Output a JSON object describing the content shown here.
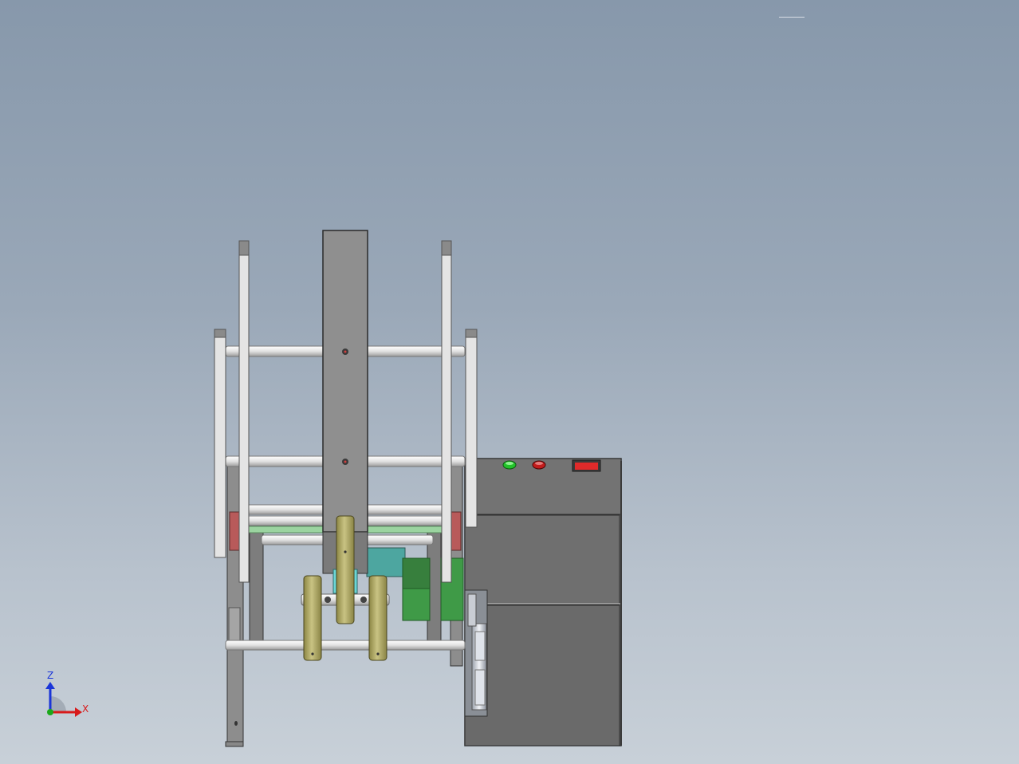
{
  "viewport": {
    "background_top": "#8798ab",
    "background_bottom": "#c8d0d8"
  },
  "triad": {
    "z_label": "Z",
    "x_label": "X",
    "z_color": "#1a35d8",
    "x_color": "#d81a1a",
    "y_color": "#1aa81a"
  },
  "control_box": {
    "start_button_color": "#22c32a",
    "stop_button_color": "#c21c1c",
    "power_switch_color": "#e02a2a"
  },
  "colors": {
    "frame_gray": "#8f8f8f",
    "panel_dark": "#6a6a6a",
    "rod_light": "#e6e6e6",
    "wheel_olive": "#a9a35e",
    "block_teal": "#4da6a0",
    "block_green": "#3f9a47",
    "accent_red": "#b85a5a"
  }
}
